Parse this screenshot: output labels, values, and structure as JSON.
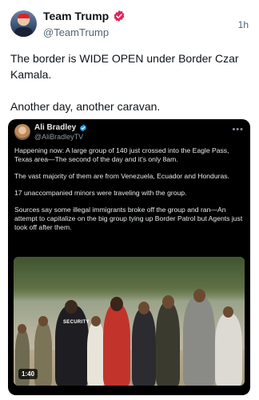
{
  "author": {
    "display_name": "Team Trump",
    "handle": "@TeamTrump",
    "time": "1h",
    "verified_color": "#e0245e",
    "avatar_icon": "avatar-photo"
  },
  "tweet": {
    "line1": "The border is WIDE OPEN under Border Czar Kamala.",
    "line2": "Another day, another caravan."
  },
  "quote": {
    "display_name": "Ali Bradley",
    "handle": "@AliBradleyTV",
    "verified_color": "#1d9bf0",
    "more_icon": "more-dots-icon",
    "paragraphs": [
      "Happening now: A large group of 140 just crossed into the Eagle Pass, Texas area—The second of the day and it's only 8am.",
      "The vast majority of them are from Venezuela, Ecuador and Honduras.",
      "17 unaccompanied minors were traveling with the group.",
      "Sources say some illegal immigrants broke off the group and ran—An attempt to capitalize on the big group tying up Border Patrol but Agents just took off after them."
    ],
    "video": {
      "duration": "1:40",
      "vest_text": "SECURITY"
    }
  }
}
